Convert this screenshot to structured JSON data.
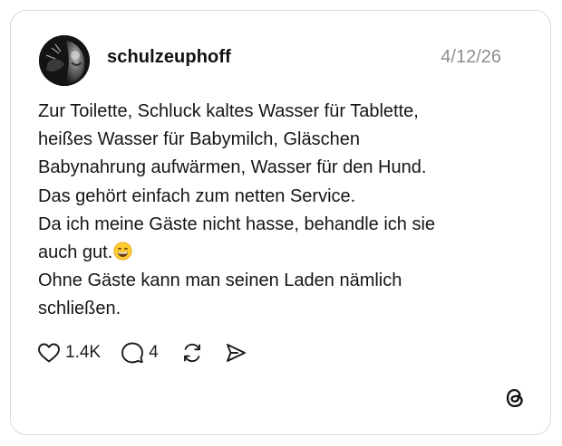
{
  "post": {
    "username": "schulzeuphoff",
    "date": "4/12/26",
    "text_lines": [
      "Zur Toilette, Schluck kaltes Wasser für Tablette,",
      "heißes Wasser für Babymilch, Gläschen",
      "Babynahrung aufwärmen, Wasser für den Hund.",
      "Das gehört einfach zum netten Service.",
      "Da ich meine Gäste nicht hasse, behandle ich sie",
      "auch gut.",
      "Ohne Gäste kann man seinen Laden nämlich",
      "schließen."
    ],
    "emoji": "grinning-face-with-smiling-eyes"
  },
  "actions": {
    "likes": "1.4K",
    "replies": "4",
    "like_icon": "heart-icon",
    "reply_icon": "speech-bubble-icon",
    "repost_icon": "repost-icon",
    "share_icon": "paper-plane-icon"
  },
  "branding": {
    "logo": "threads-logo-icon"
  },
  "colors": {
    "text": "#151515",
    "muted": "#8e8e8e",
    "border": "#d9d9d9",
    "background": "#ffffff"
  }
}
